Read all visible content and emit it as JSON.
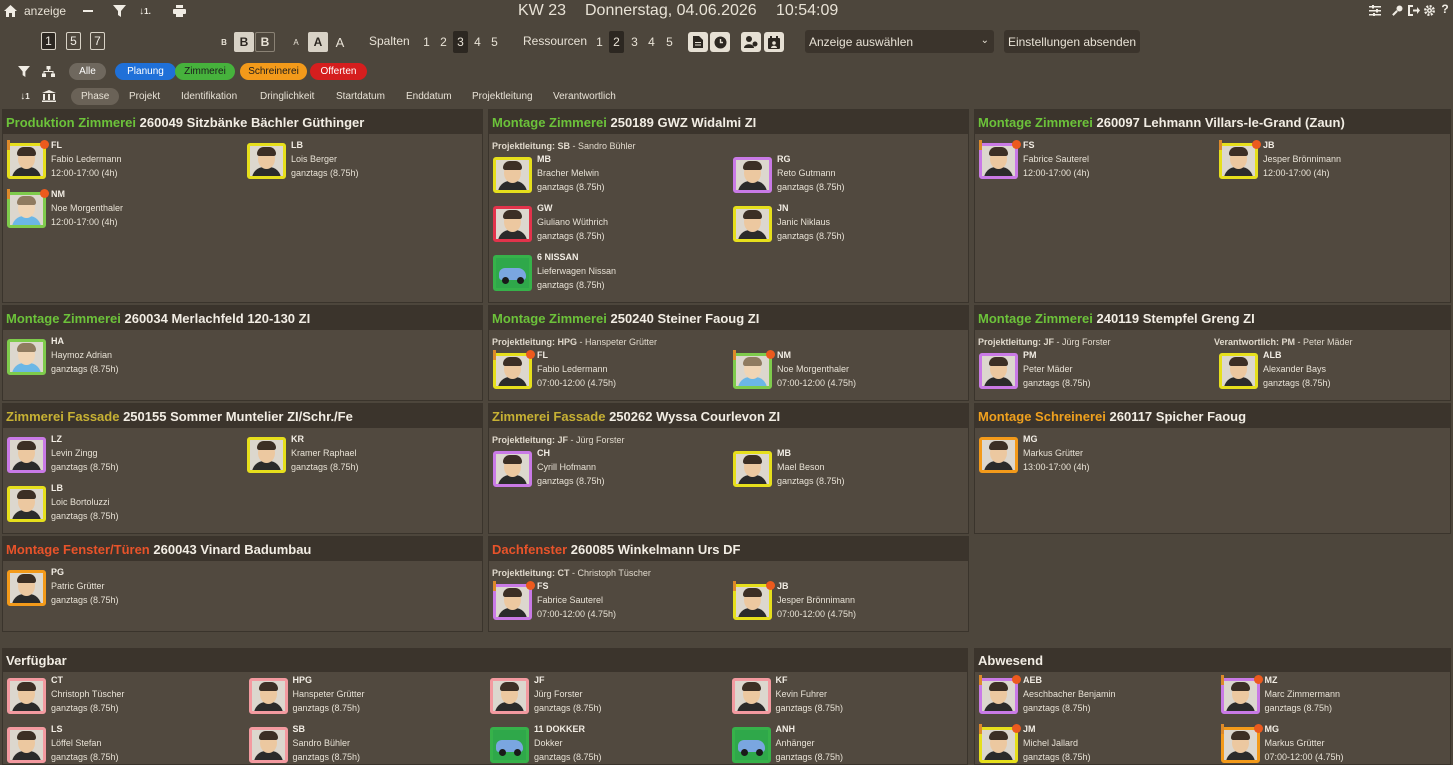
{
  "topbar": {
    "view_label": "anzeige",
    "week": "KW 23",
    "date": "Donnerstag, 04.06.2026",
    "time": "10:54:09"
  },
  "toolbar": {
    "day_options": [
      "1",
      "5",
      "7"
    ],
    "size_options": [
      "B",
      "B",
      "B"
    ],
    "font_options": [
      "A",
      "A",
      "A"
    ],
    "columns_label": "Spalten",
    "columns": [
      "1",
      "2",
      "3",
      "4",
      "5"
    ],
    "columns_selected": "3",
    "resources_label": "Ressourcen",
    "resources": [
      "1",
      "2",
      "3",
      "4",
      "5"
    ],
    "resources_selected": "2",
    "select_value": "Anzeige auswählen",
    "submit_label": "Einstellungen absenden"
  },
  "filters": [
    {
      "label": "Alle",
      "bg": "#6f685e",
      "fg": "#ffffff"
    },
    {
      "label": "Planung",
      "bg": "#1f70d8",
      "fg": "#ffffff"
    },
    {
      "label": "Zimmerei",
      "bg": "#46b23c",
      "fg": "#1c1c1c"
    },
    {
      "label": "Schreinerei",
      "bg": "#f39a1a",
      "fg": "#1c1c1c"
    },
    {
      "label": "Offerten",
      "bg": "#d51e1e",
      "fg": "#ffffff"
    }
  ],
  "sort_tabs": [
    "Phase",
    "Projekt",
    "Identifikation",
    "Dringlichkeit",
    "Startdatum",
    "Enddatum",
    "Projektleitung",
    "Verantwortlich"
  ],
  "sort_selected": "Phase",
  "colors": {
    "zimmerei": "#6cc23a",
    "fassade": "#c7b134",
    "schreinerei": "#f0a11e",
    "fenster": "#e8532a"
  },
  "projects": [
    {
      "category": "Produktion Zimmerei",
      "cat_color": "#6cc23a",
      "title": "260049 Sitzbänke Bächler Güthinger",
      "resources": [
        {
          "code": "FL",
          "name": "Fabio Ledermann",
          "time": "12:00-17:00 (4h)",
          "border": "#e6df1c",
          "badge": true
        },
        {
          "code": "LB",
          "name": "Lois Berger",
          "time": "ganztags (8.75h)",
          "border": "#e6df1c",
          "badge": false
        },
        {
          "code": "NM",
          "name": "Noe Morgenthaler",
          "time": "12:00-17:00 (4h)",
          "border": "#7ecb4c",
          "badge": true,
          "generic": true
        }
      ]
    },
    {
      "category": "Montage Zimmerei",
      "cat_color": "#6cc23a",
      "title": "250189 GWZ Widalmi ZI",
      "sub": [
        {
          "label": "Projektleitung: SB",
          "value": " - Sandro Bühler"
        }
      ],
      "resources": [
        {
          "code": "MB",
          "name": "Bracher Melwin",
          "time": "ganztags (8.75h)",
          "border": "#e6df1c"
        },
        {
          "code": "RG",
          "name": "Reto Gutmann",
          "time": "ganztags (8.75h)",
          "border": "#c97ae6"
        },
        {
          "code": "GW",
          "name": "Giuliano Wüthrich",
          "time": "ganztags (8.75h)",
          "border": "#e2334b"
        },
        {
          "code": "JN",
          "name": "Janic Niklaus",
          "time": "ganztags (8.75h)",
          "border": "#e6df1c"
        },
        {
          "code": "6 NISSAN",
          "name": "Lieferwagen Nissan",
          "time": "ganztags (8.75h)",
          "border": "#36b24a",
          "car": true
        }
      ]
    },
    {
      "category": "Montage Zimmerei",
      "cat_color": "#6cc23a",
      "title": "260097 Lehmann Villars-le-Grand (Zaun)",
      "resources": [
        {
          "code": "FS",
          "name": "Fabrice Sauterel",
          "time": "12:00-17:00 (4h)",
          "border": "#c97ae6",
          "badge": true
        },
        {
          "code": "JB",
          "name": "Jesper Brönnimann",
          "time": "12:00-17:00 (4h)",
          "border": "#e6df1c",
          "badge": true
        }
      ]
    },
    {
      "category": "Montage Zimmerei",
      "cat_color": "#6cc23a",
      "title": "260034 Merlachfeld 120-130 ZI",
      "resources": [
        {
          "code": "HA",
          "name": "Haymoz Adrian",
          "time": "ganztags (8.75h)",
          "border": "#7ecb4c",
          "generic": true
        }
      ]
    },
    {
      "category": "Montage Zimmerei",
      "cat_color": "#6cc23a",
      "title": "250240 Steiner Faoug ZI",
      "sub": [
        {
          "label": "Projektleitung: HPG",
          "value": " - Hanspeter Grütter"
        }
      ],
      "resources": [
        {
          "code": "FL",
          "name": "Fabio Ledermann",
          "time": "07:00-12:00 (4.75h)",
          "border": "#e6df1c",
          "badge": true
        },
        {
          "code": "NM",
          "name": "Noe Morgenthaler",
          "time": "07:00-12:00 (4.75h)",
          "border": "#7ecb4c",
          "badge": true,
          "generic": true
        }
      ]
    },
    {
      "category": "Montage Zimmerei",
      "cat_color": "#6cc23a",
      "title": "240119 Stempfel Greng ZI",
      "sub": [
        {
          "label": "Projektleitung: JF",
          "value": " - Jürg Forster"
        },
        {
          "label": "Verantwortlich: PM",
          "value": " - Peter Mäder"
        }
      ],
      "resources": [
        {
          "code": "PM",
          "name": "Peter Mäder",
          "time": "ganztags (8.75h)",
          "border": "#c97ae6"
        },
        {
          "code": "ALB",
          "name": "Alexander Bays",
          "time": "ganztags (8.75h)",
          "border": "#e6df1c"
        }
      ]
    },
    {
      "category": "Zimmerei Fassade",
      "cat_color": "#c7b134",
      "title": "250155 Sommer Muntelier ZI/Schr./Fe",
      "resources": [
        {
          "code": "LZ",
          "name": "Levin Zingg",
          "time": "ganztags (8.75h)",
          "border": "#c97ae6"
        },
        {
          "code": "KR",
          "name": "Kramer Raphael",
          "time": "ganztags (8.75h)",
          "border": "#e6df1c"
        },
        {
          "code": "LB",
          "name": "Loic Bortoluzzi",
          "time": "ganztags (8.75h)",
          "border": "#e6df1c"
        }
      ]
    },
    {
      "category": "Zimmerei Fassade",
      "cat_color": "#c7b134",
      "title": "250262 Wyssa Courlevon ZI",
      "sub": [
        {
          "label": "Projektleitung: JF",
          "value": " - Jürg Forster"
        }
      ],
      "resources": [
        {
          "code": "CH",
          "name": "Cyrill Hofmann",
          "time": "ganztags (8.75h)",
          "border": "#c97ae6"
        },
        {
          "code": "MB",
          "name": "Mael Beson",
          "time": "ganztags (8.75h)",
          "border": "#e6df1c"
        }
      ]
    },
    {
      "category": "Montage Schreinerei",
      "cat_color": "#f0a11e",
      "title": "260117 Spicher Faoug",
      "resources": [
        {
          "code": "MG",
          "name": "Markus Grütter",
          "time": "13:00-17:00 (4h)",
          "border": "#f39a1a"
        }
      ]
    },
    {
      "category": "Montage Fenster/Türen",
      "cat_color": "#e8532a",
      "title": "260043 Vinard Badumbau",
      "resources": [
        {
          "code": "PG",
          "name": "Patric Grütter",
          "time": "ganztags (8.75h)",
          "border": "#f39a1a"
        }
      ]
    },
    {
      "category": "Dachfenster",
      "cat_color": "#e8532a",
      "title": "260085 Winkelmann Urs DF",
      "sub": [
        {
          "label": "Projektleitung: CT",
          "value": " - Christoph Tüscher"
        }
      ],
      "resources": [
        {
          "code": "FS",
          "name": "Fabrice Sauterel",
          "time": "07:00-12:00 (4.75h)",
          "border": "#c97ae6",
          "badge": true
        },
        {
          "code": "JB",
          "name": "Jesper Brönnimann",
          "time": "07:00-12:00 (4.75h)",
          "border": "#e6df1c",
          "badge": true
        }
      ]
    }
  ],
  "available": {
    "title": "Verfügbar",
    "resources": [
      {
        "code": "CT",
        "name": "Christoph Tüscher",
        "time": "ganztags (8.75h)",
        "border": "#f39aa0"
      },
      {
        "code": "HPG",
        "name": "Hanspeter Grütter",
        "time": "ganztags (8.75h)",
        "border": "#f39aa0"
      },
      {
        "code": "JF",
        "name": "Jürg Forster",
        "time": "ganztags (8.75h)",
        "border": "#f39aa0"
      },
      {
        "code": "KF",
        "name": "Kevin Fuhrer",
        "time": "ganztags (8.75h)",
        "border": "#f39aa0"
      },
      {
        "code": "LS",
        "name": "Löffel Stefan",
        "time": "ganztags (8.75h)",
        "border": "#f39aa0"
      },
      {
        "code": "SB",
        "name": "Sandro Bühler",
        "time": "ganztags (8.75h)",
        "border": "#f39aa0"
      },
      {
        "code": "11 DOKKER",
        "name": "Dokker",
        "time": "ganztags (8.75h)",
        "border": "#36b24a",
        "car": true
      },
      {
        "code": "ANH",
        "name": "Anhänger",
        "time": "ganztags (8.75h)",
        "border": "#36b24a",
        "car": true
      }
    ]
  },
  "absent": {
    "title": "Abwesend",
    "resources": [
      {
        "code": "AEB",
        "name": "Aeschbacher Benjamin",
        "time": "ganztags (8.75h)",
        "border": "#c97ae6",
        "badge": true
      },
      {
        "code": "MZ",
        "name": "Marc Zimmermann",
        "time": "ganztags (8.75h)",
        "border": "#c97ae6",
        "badge": true
      },
      {
        "code": "JM",
        "name": "Michel Jallard",
        "time": "ganztags (8.75h)",
        "border": "#e6df1c",
        "badge": true
      },
      {
        "code": "MG",
        "name": "Markus Grütter",
        "time": "07:00-12:00 (4.75h)",
        "border": "#f39a1a",
        "badge": true
      }
    ]
  }
}
